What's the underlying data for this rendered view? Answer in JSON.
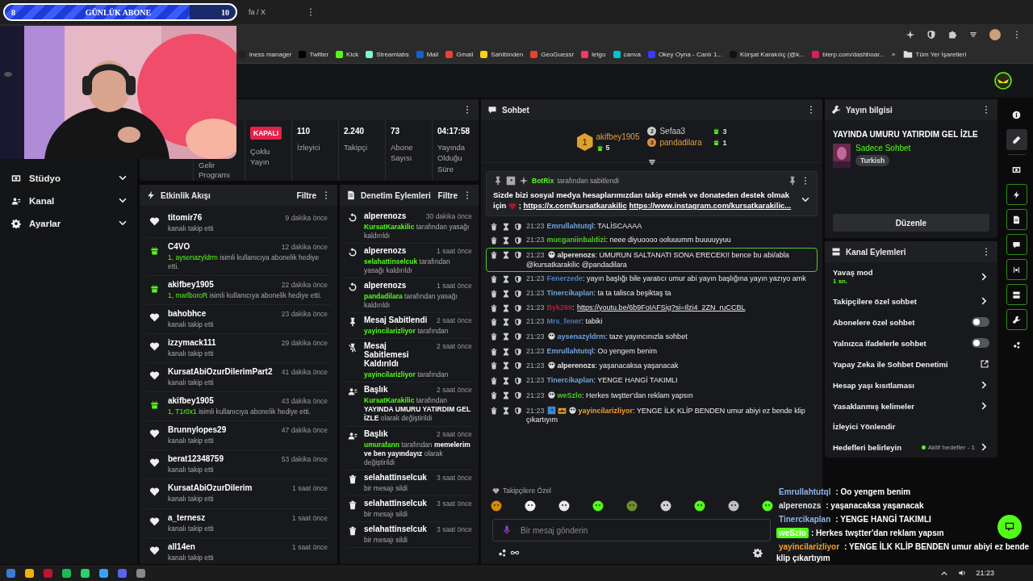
{
  "goal_overlay": {
    "start": "8",
    "title": "GÜNLÜK ABONE",
    "end": "10",
    "level": 0.8
  },
  "browser": {
    "tab_title": "fa / X",
    "bookmarks": [
      "iness manager",
      "Twitter",
      "Kick",
      "Streamlabs",
      "Mail",
      "Gmail",
      "Sahibinden",
      "GeoGuessr",
      "letgo",
      "canva",
      "Okey Oyna - Canlı 1...",
      "Kürşat Karakılıç (@k...",
      "blerp.com/dashboar..."
    ],
    "more": "»",
    "all_bookmarks": "Tüm Yer İşaretleri"
  },
  "sidebar": {
    "items": [
      {
        "label": "Stüdyo"
      },
      {
        "label": "Kanal"
      },
      {
        "label": "Ayarlar"
      }
    ]
  },
  "stats": [
    {
      "kind": "label",
      "label": "Gelir Programı"
    },
    {
      "kind": "badge",
      "badge": "KAPALI",
      "label": "Çoklu Yayın"
    },
    {
      "kind": "value",
      "value": "110",
      "label": "İzleyici"
    },
    {
      "kind": "value",
      "value": "2.240",
      "label": "Takipçi"
    },
    {
      "kind": "value",
      "value": "73",
      "label": "Abone Sayısı"
    },
    {
      "kind": "value",
      "value": "04:17:58",
      "label": "Yayında Olduğu Süre"
    }
  ],
  "activity": {
    "title": "Etkinlik Akışı",
    "filter": "Filtre",
    "items": [
      {
        "kind": "follow",
        "user": "titomir76",
        "time": "9 dakika önce",
        "text": "kanalı takip etti"
      },
      {
        "kind": "gift",
        "user": "C4VO",
        "time": "12 dakika önce",
        "highlight": "1, aysenazyldrm",
        "text": "isimli kullanıcıya abonelik hediye etti."
      },
      {
        "kind": "gift",
        "user": "akifbey1905",
        "time": "22 dakika önce",
        "highlight": "1, marlboroR",
        "text": "isimli kullanıcıya abonelik hediye etti."
      },
      {
        "kind": "follow",
        "user": "bahobhce",
        "time": "23 dakika önce",
        "text": "kanalı takip etti"
      },
      {
        "kind": "follow",
        "user": "izzymack111",
        "time": "29 dakika önce",
        "text": "kanalı takip etti"
      },
      {
        "kind": "follow",
        "user": "KursatAbiOzurDilerimPart2",
        "time": "41 dakika önce",
        "text": "kanalı takip etti"
      },
      {
        "kind": "gift",
        "user": "akifbey1905",
        "time": "43 dakika önce",
        "highlight": "1, T1r0x1",
        "text": "isimli kullanıcıya abonelik hediye etti."
      },
      {
        "kind": "follow",
        "user": "Brunnylopes29",
        "time": "47 dakika önce",
        "text": "kanalı takip etti"
      },
      {
        "kind": "follow",
        "user": "berat12348759",
        "time": "53 dakika önce",
        "text": "kanalı takip etti"
      },
      {
        "kind": "follow",
        "user": "KursatAbiOzurDilerim",
        "time": "1 saat önce",
        "text": "kanalı takip etti"
      },
      {
        "kind": "follow",
        "user": "a_ternesz",
        "time": "1 saat önce",
        "text": "kanalı takip etti"
      },
      {
        "kind": "follow",
        "user": "all14en",
        "time": "1 saat önce",
        "text": "kanalı takip etti"
      }
    ]
  },
  "moderation": {
    "title": "Denetim Eylemleri",
    "filter": "Filtre",
    "items": [
      {
        "kind": "unban",
        "title": "alperenozs",
        "time": "30 dakika önce",
        "actor": "KursatKarakilic",
        "text": "tarafından yasağı kaldırıldı"
      },
      {
        "kind": "unban",
        "title": "alperenozs",
        "time": "1 saat önce",
        "actor": "selahattinselcuk",
        "text": "tarafından yasağı kaldırıldı"
      },
      {
        "kind": "unban",
        "title": "alperenozs",
        "time": "1 saat önce",
        "actor": "pandadilara",
        "text": "tarafından yasağı kaldırıldı"
      },
      {
        "kind": "pin",
        "title": "Mesaj Sabitlendi",
        "time": "2 saat önce",
        "actor": "yayincilarizliyor",
        "text": "tarafından"
      },
      {
        "kind": "unpin",
        "title": "Mesaj Sabitlemesi Kaldırıldı",
        "time": "2 saat önce",
        "actor": "yayincilarizliyor",
        "text": "tarafından"
      },
      {
        "kind": "title",
        "title": "Başlık",
        "time": "2 saat önce",
        "actor": "KursatKarakilic",
        "text": "tarafından **YAYINDA UMURU YATIRDIM GEL İZLE** olarak değiştirildi"
      },
      {
        "kind": "title",
        "title": "Başlık",
        "time": "2 saat önce",
        "actor": "umurafann",
        "text": "tarafından **memelerim ve ben yayındayız** olarak değiştirildi"
      },
      {
        "kind": "delete",
        "title": "selahattinselcuk",
        "time": "3 saat önce",
        "text": "bir mesajı sildi"
      },
      {
        "kind": "delete",
        "title": "selahattinselcuk",
        "time": "3 saat önce",
        "text": "bir mesajı sildi"
      },
      {
        "kind": "delete",
        "title": "selahattinselcuk",
        "time": "3 saat önce",
        "text": "bir mesajı sildi"
      }
    ]
  },
  "chat": {
    "title": "Sohbet",
    "gifters": [
      {
        "rank": "1",
        "name": "akifbey1905",
        "count": "5"
      },
      {
        "rank": "2",
        "name": "Sefaa3",
        "count": "3"
      },
      {
        "rank": "3",
        "name": "pandadilara",
        "count": "1"
      }
    ],
    "pinned": {
      "user": "BotRix",
      "by": "tarafından sabitlendi",
      "text": "Sizde bizi sosyal medya hesaplarımızdan takip etmek ve donateden destek olmak için",
      "sep": ";",
      "links": [
        "https://x.com/kursatkarakilic",
        "https://www.instagram.com/kursatkarakilic..."
      ]
    },
    "messages": [
      {
        "time": "21:23",
        "user": "Emrullahtutql",
        "color": "#6fa3dc",
        "text": ": TALİSCAAAA",
        "highlighted": false
      },
      {
        "time": "21:23",
        "user": "mucganiinbaldizi",
        "color": "#53c62a",
        "text": ": neee diyuoooo ooluuumm buuuuyyuu",
        "highlighted": false
      },
      {
        "time": "21:23",
        "user": "alperenozs",
        "color": "#e6e6e6",
        "text": ": UMURUN SALTANATI SONA ERECEK!! bence bu abi/abla @kursatkarakilic @pandadilara",
        "highlighted": true,
        "badges": [
          {
            "kind": "emote"
          }
        ]
      },
      {
        "time": "21:23",
        "user": "Fenerzede",
        "color": "#4d7fc4",
        "text": ": yayın başlığı bile yaratıcı umur abi yayın başlığına yayın yazıyo amk",
        "highlighted": false
      },
      {
        "time": "21:23",
        "user": "Tinercikaplan",
        "color": "#6fa3dc",
        "text": ": ta ta talisca beşiktaş ta",
        "highlighted": false
      },
      {
        "time": "21:23",
        "user": "Byk299",
        "color": "#b51c3c",
        "text": ":",
        "link": "https://youtu.be/6b9FoIAFSig?si=Ilzi4_2ZN_ruCCBL",
        "highlighted": false
      },
      {
        "time": "21:23",
        "user": "Mrs_fener",
        "color": "#4a7bb8",
        "text": ": tabiki",
        "highlighted": false
      },
      {
        "time": "21:23",
        "user": "aysenazyldrm",
        "color": "#6e9fd8",
        "text": ": taze yayıncınızla sohbet",
        "highlighted": false,
        "badges": [
          {
            "kind": "emote"
          }
        ]
      },
      {
        "time": "21:23",
        "user": "Emrullahtutql",
        "color": "#6fa3dc",
        "text": ": Oo yengem benim",
        "highlighted": false
      },
      {
        "time": "21:23",
        "user": "alperenozs",
        "color": "#e6e6e6",
        "text": ": yaşanacaksa yaşanacak",
        "highlighted": false,
        "badges": [
          {
            "kind": "emote"
          }
        ]
      },
      {
        "time": "21:23",
        "user": "Tinercikaplan",
        "color": "#6fa3dc",
        "text": ": YENGE HANGİ TAKIMLI",
        "highlighted": false
      },
      {
        "time": "21:23",
        "user": "weSzlo",
        "color": "#53c62a",
        "text": ": Herkes twştter'dan reklam yapsın",
        "highlighted": false,
        "badges": [
          {
            "kind": "emote"
          }
        ]
      },
      {
        "time": "21:23",
        "user": "yayincilarizliyor",
        "color": "#f0a030",
        "text": ": YENGE İLK KLİP BENDEN umur abiyi ez bende klip çıkartıyım",
        "highlighted": false,
        "badges": [
          {
            "kind": "moderator"
          },
          {
            "kind": "crown"
          },
          {
            "kind": "emote"
          }
        ]
      }
    ],
    "emote_label": "Takipçilere Özel",
    "input": {
      "placeholder": "Bir mesaj gönderin"
    }
  },
  "stream_info": {
    "title": "Yayın bilgisi",
    "stream_title": "YAYINDA UMURU YATIRDIM GEL İZLE",
    "category": "Sadece Sohbet",
    "tag": "Turkish",
    "button": "Düzenle"
  },
  "channel_actions": {
    "title": "Kanal Eylemleri",
    "items": [
      {
        "kind": "chevron",
        "label": "Yavaş mod",
        "sub": "1 sn."
      },
      {
        "kind": "chevron",
        "label": "Takipçilere özel sohbet"
      },
      {
        "kind": "toggle",
        "label": "Abonelere özel sohbet",
        "on": false
      },
      {
        "kind": "toggle",
        "label": "Yalnızca ifadelerle sohbet",
        "on": false
      },
      {
        "kind": "external",
        "label": "Yapay Zeka ile Sohbet Denetimi"
      },
      {
        "kind": "chevron",
        "label": "Hesap yaşı kısıtlaması"
      },
      {
        "kind": "chevron",
        "label": "Yasaklanmış kelimeler"
      },
      {
        "kind": "plain",
        "label": "İzleyici Yönlendir"
      },
      {
        "kind": "goal",
        "label": "Hedefleri belirleyin",
        "status": "Aktif hedefler - 1"
      }
    ]
  },
  "rail": [
    {
      "selected": false,
      "open": false
    },
    {
      "selected": true,
      "open": false
    },
    {
      "selected": false,
      "open": false
    },
    {
      "selected": false,
      "open": true
    },
    {
      "selected": false,
      "open": true
    },
    {
      "selected": false,
      "open": true
    },
    {
      "selected": false,
      "open": true
    },
    {
      "selected": false,
      "open": true
    },
    {
      "selected": false,
      "open": true
    },
    {
      "selected": false,
      "open": false
    }
  ],
  "chat_overlay": [
    {
      "user": "Emrullahtutql",
      "color": "#8fb3e8",
      "text": ": Oo yengem benim",
      "highlighted": false
    },
    {
      "user": "alperenozs",
      "color": "#e6e6e6",
      "text": ": yaşanacaksa yaşanacak",
      "highlighted": false
    },
    {
      "user": "Tinercikaplan",
      "color": "#8fb3e8",
      "text": ": YENGE HANGİ TAKIMLI",
      "highlighted": false
    },
    {
      "user": "weSzlo",
      "text": ": Herkes twştter'dan reklam yapsın",
      "highlighted": true
    },
    {
      "user": "yayincilarizliyor",
      "color": "#f0a030",
      "text": ": YENGE İLK KLİP BENDEN umur abiyi ez bende klip çıkartıyım",
      "highlighted": false
    }
  ],
  "taskbar": {
    "time": "21:23"
  }
}
